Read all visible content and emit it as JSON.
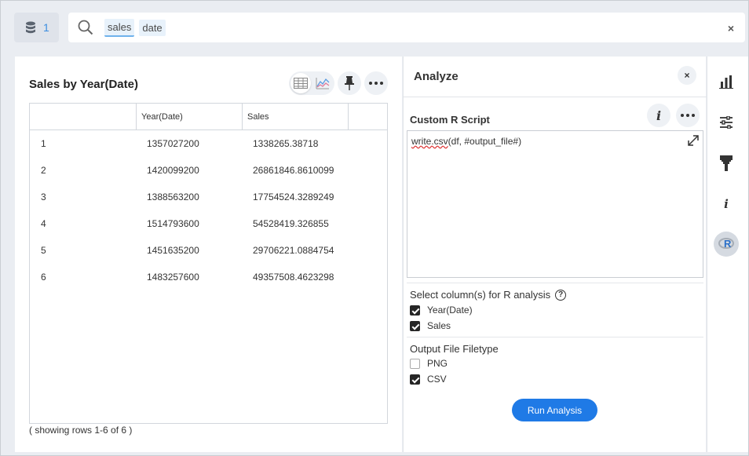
{
  "topbar": {
    "source_count": "1",
    "search_tokens": [
      "sales",
      "date"
    ],
    "clear_label": "×"
  },
  "visualization": {
    "title": "Sales by Year(Date)",
    "columns": [
      "",
      "Year(Date)",
      "Sales"
    ],
    "rows": [
      [
        "1",
        "1357027200",
        "1338265.38718"
      ],
      [
        "2",
        "1420099200",
        "26861846.8610099"
      ],
      [
        "3",
        "1388563200",
        "17754524.3289249"
      ],
      [
        "4",
        "1514793600",
        "54528419.326855"
      ],
      [
        "5",
        "1451635200",
        "29706221.0884754"
      ],
      [
        "6",
        "1483257600",
        "49357508.4623298"
      ]
    ],
    "footer": "( showing rows 1-6 of 6 )"
  },
  "analyze": {
    "title": "Analyze",
    "close_label": "×",
    "script_label": "Custom R Script",
    "script_fn": "write.csv",
    "script_rest": "(df,  #output_file#)",
    "columns_label": "Select column(s) for R analysis",
    "help_label": "?",
    "columns": [
      {
        "label": "Year(Date)",
        "checked": true
      },
      {
        "label": "Sales",
        "checked": true
      }
    ],
    "filetype_label": "Output File Filetype",
    "filetypes": [
      {
        "label": "PNG",
        "checked": false
      },
      {
        "label": "CSV",
        "checked": true
      }
    ],
    "run_label": "Run Analysis"
  },
  "rail": {
    "info_glyph": "i",
    "r_glyph": "R"
  },
  "colors": {
    "accent": "#1f7ae6",
    "token_bg": "#e8f2fb"
  }
}
